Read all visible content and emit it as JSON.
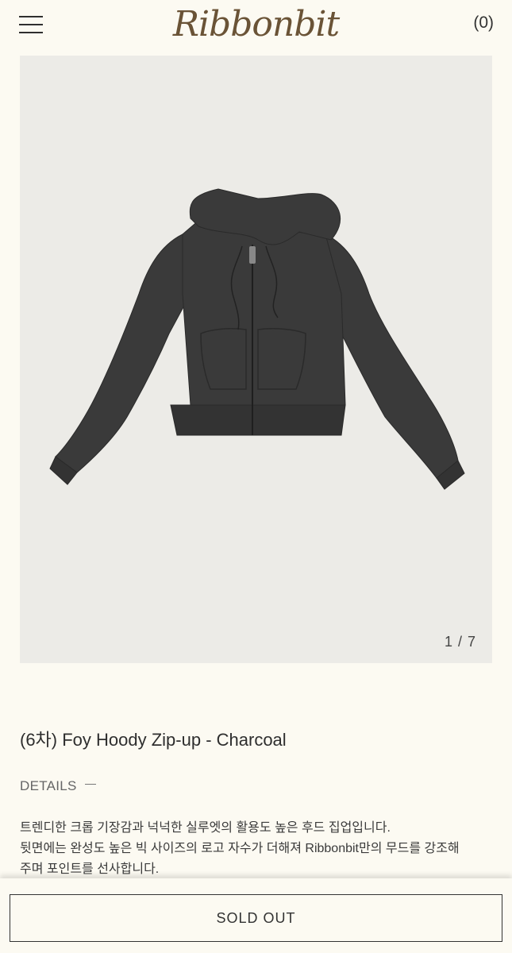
{
  "header": {
    "logo": "Ribbonbit",
    "cart_count": "(0)"
  },
  "gallery": {
    "counter": "1 / 7"
  },
  "product": {
    "title": "(6차) Foy Hoody Zip-up - Charcoal",
    "details_label": "DETAILS",
    "description_lines": [
      "트렌디한 크롭 기장감과 넉넉한 실루엣의 활용도 높은 후드 집업입니다.",
      "뒷면에는 완성도 높은 빅 사이즈의 로고 자수가 더해져 Ribbonbit만의 무드를 강조해",
      "주며 포인트를 선사합니다."
    ]
  },
  "actions": {
    "sold_out_label": "SOLD OUT"
  },
  "colors": {
    "background": "#fcfaf2",
    "image_background": "#ecebe7",
    "hoodie": "#3a3a3a",
    "logo": "#6a5336"
  }
}
